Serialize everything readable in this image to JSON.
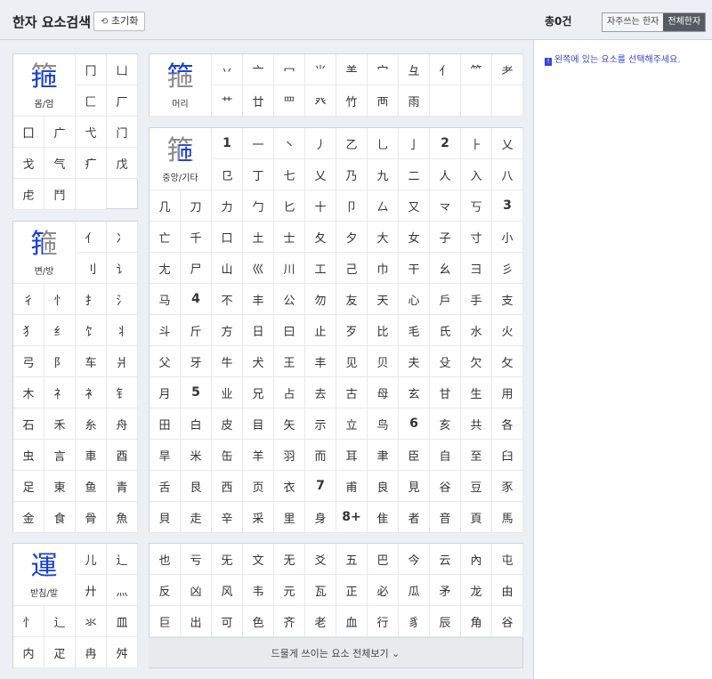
{
  "header": {
    "title": "한자 요소검색",
    "reset_label": "초기화"
  },
  "right": {
    "total": "총0건",
    "tab_common": "자주쓰는 한자",
    "tab_all": "전체한자",
    "hint": "왼쪽에 있는 요소를 선택해주세요.",
    "hint_icon": "!"
  },
  "sections": {
    "enclosure": {
      "char": "箍",
      "label": "몸/엄",
      "cells": [
        "冂",
        "凵",
        "匚",
        "厂",
        "囗",
        "广",
        "弋",
        "门",
        "戈",
        "气",
        "疒",
        "戊",
        "虍",
        "鬥",
        ""
      ]
    },
    "head": {
      "char": "箍",
      "label": "머리",
      "cells": [
        "丷",
        "亠",
        "冖",
        "⺌",
        "⺷",
        "宀",
        "彑",
        "⺅",
        "⺮",
        "耂",
        "艹",
        "廿",
        "罒",
        "癶",
        "竹",
        "襾",
        "雨",
        "",
        "",
        ""
      ]
    },
    "side": {
      "char": "箍",
      "label": "변/방",
      "cells": [
        "亻",
        "冫",
        "刂",
        "讠",
        "彳",
        "忄",
        "扌",
        "氵",
        "犭",
        "纟",
        "饣",
        "丬",
        "弓",
        "阝",
        "车",
        "爿",
        "木",
        "礻",
        "衤",
        "钅",
        "石",
        "禾",
        "糸",
        "舟",
        "虫",
        "言",
        "車",
        "酉",
        "足",
        "東",
        "鱼",
        "青",
        "金",
        "食",
        "骨",
        "魚"
      ]
    },
    "middle": {
      "char": "箍",
      "label": "중앙/기타",
      "cells": [
        "1",
        "一",
        "丶",
        "丿",
        "乙",
        "乚",
        "亅",
        "2",
        "⺊",
        "乂",
        "㔾",
        "丁",
        "七",
        "乂",
        "乃",
        "九",
        "二",
        "人",
        "入",
        "八",
        "几",
        "刀",
        "力",
        "勹",
        "匕",
        "十",
        "卩",
        "厶",
        "又",
        "龴",
        "丂",
        "3",
        "亡",
        "千",
        "口",
        "土",
        "士",
        "夂",
        "夕",
        "大",
        "女",
        "子",
        "寸",
        "小",
        "尢",
        "尸",
        "山",
        "巛",
        "川",
        "工",
        "己",
        "巾",
        "干",
        "幺",
        "彐",
        "彡",
        "马",
        "4",
        "不",
        "丰",
        "公",
        "勿",
        "友",
        "天",
        "心",
        "戶",
        "手",
        "支",
        "斗",
        "斤",
        "方",
        "日",
        "曰",
        "止",
        "歹",
        "比",
        "毛",
        "氏",
        "水",
        "火",
        "父",
        "牙",
        "牛",
        "犬",
        "王",
        "丰",
        "见",
        "贝",
        "夫",
        "殳",
        "欠",
        "攵",
        "月",
        "5",
        "业",
        "兄",
        "占",
        "去",
        "古",
        "母",
        "玄",
        "甘",
        "生",
        "用",
        "田",
        "白",
        "皮",
        "目",
        "矢",
        "示",
        "立",
        "鸟",
        "6",
        "亥",
        "共",
        "各",
        "旱",
        "米",
        "缶",
        "羊",
        "羽",
        "而",
        "耳",
        "聿",
        "臣",
        "自",
        "至",
        "臼",
        "舌",
        "艮",
        "西",
        "页",
        "衣",
        "7",
        "甫",
        "良",
        "見",
        "谷",
        "豆",
        "豕",
        "貝",
        "走",
        "辛",
        "采",
        "里",
        "身",
        "8+",
        "隹",
        "者",
        "音",
        "頁",
        "馬"
      ]
    },
    "bottom": {
      "char": "運",
      "label": "받침/발",
      "cells": [
        "儿",
        "辶",
        "廾",
        "灬",
        "忄",
        "辶",
        "氺",
        "皿",
        "内",
        "疋",
        "冉",
        "舛"
      ]
    },
    "extra": {
      "cells": [
        "也",
        "亏",
        "旡",
        "文",
        "无",
        "爻",
        "五",
        "巴",
        "今",
        "云",
        "內",
        "屯",
        "反",
        "凶",
        "风",
        "韦",
        "元",
        "瓦",
        "正",
        "必",
        "瓜",
        "矛",
        "龙",
        "由",
        "巨",
        "出",
        "可",
        "色",
        "齐",
        "老",
        "血",
        "行",
        "豸",
        "辰",
        "角",
        "谷"
      ],
      "more_label": "드물게 쓰이는 요소 전체보기 ⌄"
    }
  },
  "colors": {
    "highlight": "#1a3fd6",
    "hint": "#3b45d6"
  }
}
